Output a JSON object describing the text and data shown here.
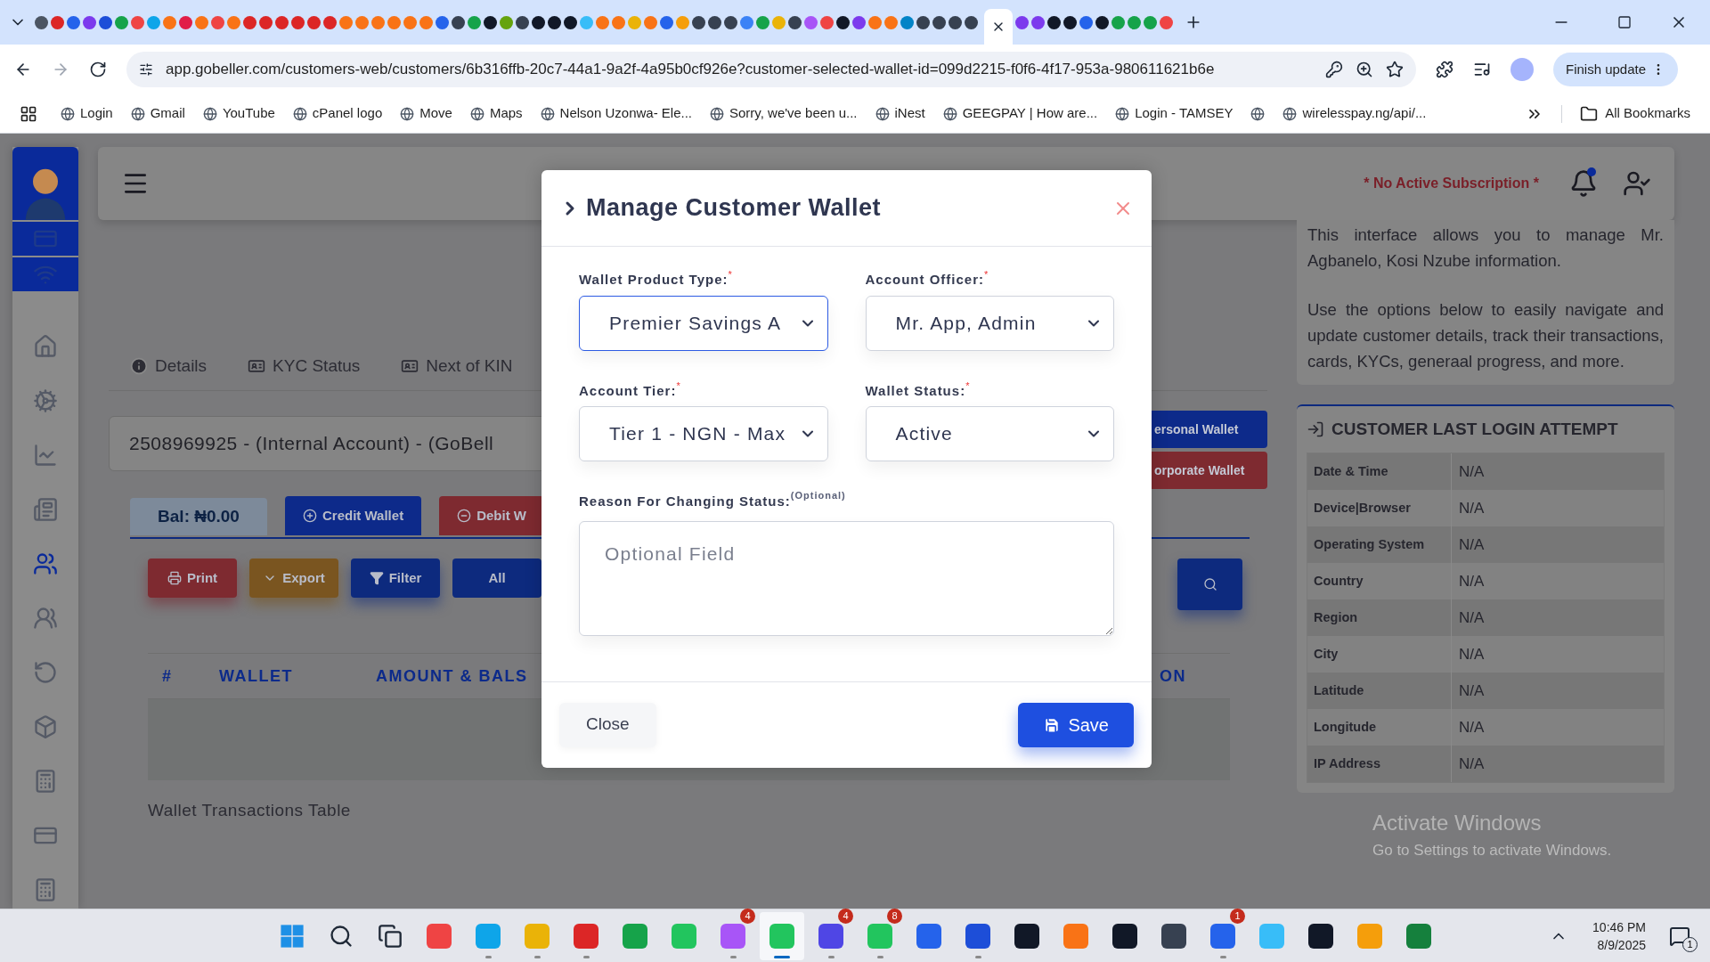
{
  "browser": {
    "url": "app.gobeller.com/customers-web/customers/6b316ffb-20c7-44a1-9a2f-4a95b0cf926e?customer-selected-wallet-id=099d2215-f0f6-4f17-953a-980611621b6e",
    "update_button": "Finish update",
    "all_bookmarks": "All Bookmarks",
    "bookmarks": [
      {
        "kind": "link",
        "label": "Login"
      },
      {
        "kind": "link",
        "label": "Gmail"
      },
      {
        "kind": "link",
        "label": "YouTube"
      },
      {
        "kind": "link",
        "label": "cPanel logo"
      },
      {
        "kind": "link",
        "label": "Move"
      },
      {
        "kind": "link",
        "label": "Maps"
      },
      {
        "kind": "link",
        "label": "Nelson Uzonwa- Ele..."
      },
      {
        "kind": "link",
        "label": "Sorry, we've been u..."
      },
      {
        "kind": "link",
        "label": "iNest"
      },
      {
        "kind": "link",
        "label": "GEEGPAY | How are..."
      },
      {
        "kind": "link",
        "label": "Login - TAMSEY"
      },
      {
        "kind": "icon"
      },
      {
        "kind": "link",
        "label": "wirelesspay.ng/api/..."
      }
    ]
  },
  "header": {
    "subscription": "* No Active Subscription *",
    "notification_dot": true
  },
  "tabs": [
    {
      "label": "Details",
      "kind": "info"
    },
    {
      "label": "KYC Status",
      "kind": "card"
    },
    {
      "label": "Next of KIN",
      "kind": "card"
    }
  ],
  "account_select": "2508969925 - (Internal Account) - (GoBell",
  "wallet_buttons": [
    {
      "label": "ersonal Wallet",
      "kind": "primary"
    },
    {
      "label": "orporate Wallet",
      "kind": "danger"
    }
  ],
  "balance": "Bal: ₦0.00",
  "wallet_actions": [
    {
      "label": "Credit Wallet",
      "kind": "primary"
    },
    {
      "label": "Debit W",
      "kind": "danger"
    }
  ],
  "toolbar": [
    {
      "label": "Print",
      "kind": "print"
    },
    {
      "label": "Export",
      "kind": "export"
    },
    {
      "label": "Filter",
      "kind": "filter"
    },
    {
      "label": "All",
      "kind": "plain"
    }
  ],
  "table": {
    "columns": [
      "#",
      "WALLET",
      "AMOUNT & BALS",
      "ON"
    ],
    "caption": "Wallet Transactions Table"
  },
  "info": {
    "paragraphs": [
      "This interface allows you to manage Mr. Agbanelo, Kosi Nzube information.",
      "Use the options below to easily navigate and update customer details, track their transactions, cards, KYCs, generaal progress, and more."
    ]
  },
  "login_attempt": {
    "title": "CUSTOMER LAST LOGIN ATTEMPT",
    "rows": [
      {
        "label": "Date & Time",
        "value": "N/A"
      },
      {
        "label": "Device|Browser",
        "value": "N/A"
      },
      {
        "label": "Operating System",
        "value": "N/A"
      },
      {
        "label": "Country",
        "value": "N/A"
      },
      {
        "label": "Region",
        "value": "N/A"
      },
      {
        "label": "City",
        "value": "N/A"
      },
      {
        "label": "Latitude",
        "value": "N/A"
      },
      {
        "label": "Longitude",
        "value": "N/A"
      },
      {
        "label": "IP Address",
        "value": "N/A"
      }
    ]
  },
  "activation": {
    "title": "Activate Windows",
    "subtitle": "Go to Settings to activate Windows."
  },
  "modal": {
    "title": "Manage Customer Wallet",
    "fields": [
      {
        "label": "Wallet Product Type:",
        "required_mark": "*",
        "value": "Premier Savings A",
        "focused": true
      },
      {
        "label": "Account Officer:",
        "required_mark": "*",
        "value": "Mr. App, Admin",
        "focused": false
      },
      {
        "label": "Account Tier:",
        "required_mark": "*",
        "value": "Tier 1 - NGN - Max",
        "focused": false
      },
      {
        "label": "Wallet Status:",
        "required_mark": "*",
        "value": "Active",
        "focused": false
      }
    ],
    "reason": {
      "label": "Reason For Changing Status:",
      "note": "(Optional)",
      "placeholder": "Optional Field"
    },
    "close_button": "Close",
    "save_button": "Save"
  },
  "taskbar": {
    "apps": [
      {
        "kind": "start"
      },
      {
        "kind": "search"
      },
      {
        "kind": "taskview"
      },
      {
        "kind": "app",
        "open": false
      },
      {
        "kind": "app",
        "open": true
      },
      {
        "kind": "app",
        "open": true
      },
      {
        "kind": "app",
        "open": true
      },
      {
        "kind": "app",
        "open": false
      },
      {
        "kind": "app",
        "open": false
      },
      {
        "kind": "app",
        "open": true,
        "badge": "4"
      },
      {
        "kind": "app",
        "open": true,
        "active": true
      },
      {
        "kind": "app",
        "open": true,
        "badge": "4"
      },
      {
        "kind": "app",
        "open": true,
        "badge": "8"
      },
      {
        "kind": "app",
        "open": false
      },
      {
        "kind": "app",
        "open": true
      },
      {
        "kind": "app",
        "open": false
      },
      {
        "kind": "app",
        "open": false
      },
      {
        "kind": "app",
        "open": false
      },
      {
        "kind": "app",
        "open": false
      },
      {
        "kind": "app",
        "open": true,
        "badge": "1"
      },
      {
        "kind": "app",
        "open": false
      },
      {
        "kind": "app",
        "open": false
      },
      {
        "kind": "app",
        "open": false
      },
      {
        "kind": "app",
        "open": false
      }
    ],
    "time": "10:46 PM",
    "date": "8/9/2025",
    "notifications": "1"
  }
}
